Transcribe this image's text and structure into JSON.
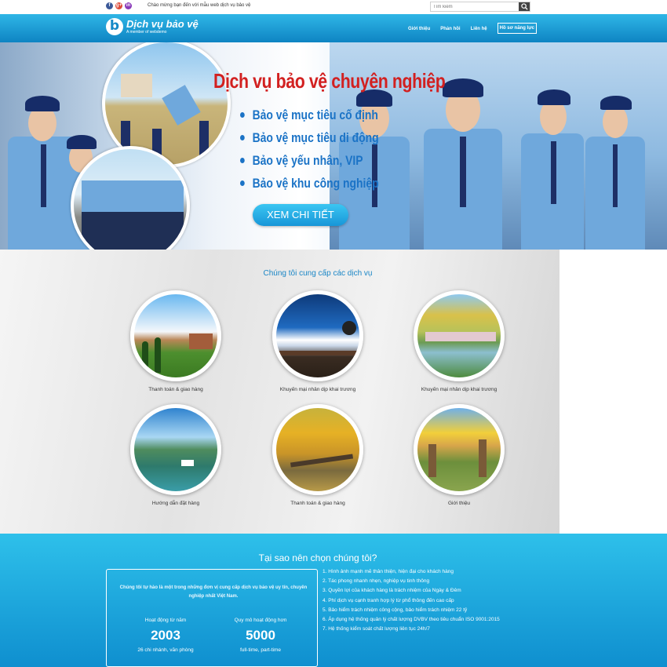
{
  "topbar": {
    "social": [
      "f",
      "g+",
      "in"
    ],
    "welcome": "Chào mừng bạn đến với mẫu web dịch vụ bảo vệ",
    "search_placeholder": "Tìm kiếm"
  },
  "header": {
    "logo_letter": "b",
    "logo_name": "Dịch vụ bảo vệ",
    "logo_tag": "A member of webdemo",
    "nav": [
      "Giới thiệu",
      "Phản hồi",
      "Liên hệ",
      "Hồ sơ năng lực"
    ]
  },
  "hero": {
    "title": "Dịch vụ bảo vệ chuyên nghiệp",
    "items": [
      "Bảo vệ mục tiêu cố định",
      "Bảo vệ mục tiêu di động",
      "Bảo vệ yếu nhân, VIP",
      "Bảo vệ khu công nghiệp"
    ],
    "button": "XEM CHI TIẾT"
  },
  "services": {
    "title": "Chúng tôi cung cấp các dịch vụ",
    "items": [
      {
        "label": "Thanh toán & giao hàng",
        "image": "campus-landscape"
      },
      {
        "label": "Khuyến mại nhân dịp khai trương",
        "image": "mountain-balcony"
      },
      {
        "label": "Khuyến mại nhân dịp khai trương",
        "image": "autumn-lake"
      },
      {
        "label": "Hướng dẫn đặt hàng",
        "image": "halong-bay"
      },
      {
        "label": "Thanh toán & giao hàng",
        "image": "autumn-path"
      },
      {
        "label": "Giới thiệu",
        "image": "autumn-park"
      }
    ]
  },
  "why": {
    "title": "Tại sao nên chọn chúng tôi?",
    "intro": "Chúng tôi tự hào là một trong những đơn vị cung cấp dịch vụ bảo vệ uy tín, chuyên nghiệp nhất Việt Nam.",
    "stats": [
      {
        "label": "Hoạt động từ năm",
        "value": "2003",
        "sub": "26 chi nhánh, văn phòng"
      },
      {
        "label": "Quy mô hoạt động hơn",
        "value": "5000",
        "sub": "full-time, part-time"
      }
    ],
    "reasons": [
      "1. Hình ảnh mạnh mẽ thân thiện, hiện đại cho khách hàng",
      "2. Tác phong nhanh nhẹn, nghiệp vụ tinh thông",
      "3. Quyền lợi của khách hàng là trách nhiệm của Ngày & Đêm",
      "4. Phí dịch vụ cạnh tranh hợp lý từ phổ thông đến cao cấp",
      "5. Bảo hiểm trách nhiệm công cộng, bảo hiểm trách nhiệm 22 tỷ",
      "6. Áp dụng hệ thống quản lý chất lượng DVBV theo tiêu chuẩn ISO 9001:2015",
      "7. Hệ thống kiểm soát chất lượng liên tục 24h/7"
    ]
  },
  "colors": {
    "brand_blue": "#1a86c6",
    "hero_title_red": "#d22020",
    "header_gradient_top": "#2fb6e6",
    "header_gradient_bottom": "#0e84c3"
  }
}
